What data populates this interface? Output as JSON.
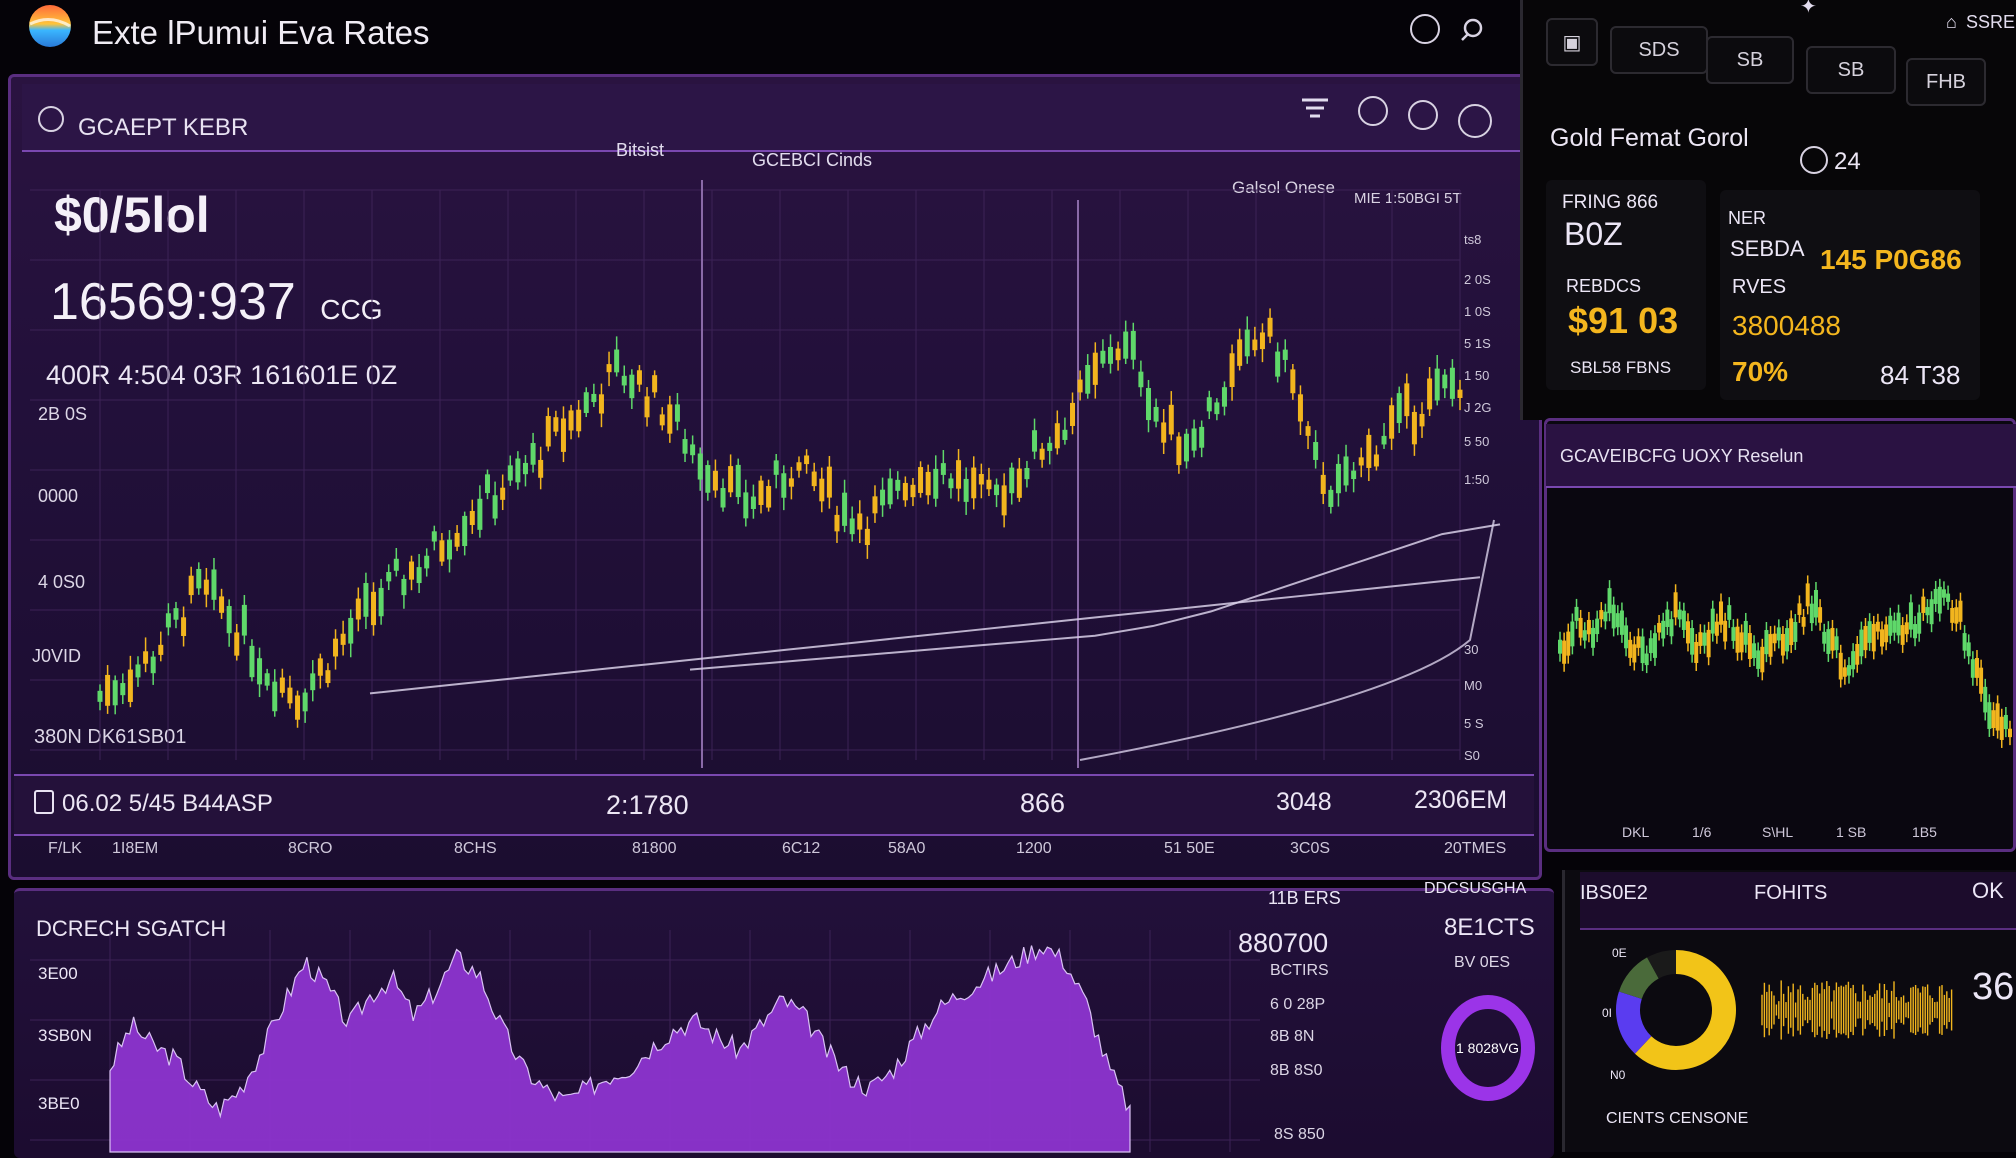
{
  "app": {
    "title": "Exte lPumui Eva Rates",
    "logo_icon": "globe-logo-icon"
  },
  "header": {
    "icons": [
      "refresh-icon",
      "settings-icon"
    ]
  },
  "main_panel": {
    "title": "GCAEPT KEBR",
    "subtabs": [
      "Bitsist",
      "GCEBCI Cinds"
    ],
    "toolbar_icons": [
      "menu-icon",
      "pause-icon",
      "clock-icon",
      "globe-icon"
    ],
    "price_small": "$0/5lol",
    "price_big": "16569:937",
    "price_big_suffix": "CCG",
    "price_sub": "400R 4:504 03R 161601E 0Z",
    "legend_left": "Galsol Onese",
    "legend_right": "MIE 1:50BGI 5T",
    "y_labels_left": [
      "2B 0S",
      "0000",
      "4 0S0",
      "J0VID",
      "380N DK61SB01"
    ],
    "y_labels_right": [
      "ts8",
      "2 0S",
      "1 0S",
      "5 1S",
      "1 50",
      "J 2G",
      "5 50",
      "1:50",
      "30",
      "M0",
      "5 S",
      "S0"
    ],
    "footer_stats": [
      "06.02 5/45 B44ASP",
      "2:1780",
      "866",
      "3048",
      "2306EM"
    ],
    "footer_icon": "document-icon",
    "x_labels": [
      "F/LK",
      "1I8EM",
      "8CRO",
      "8CHS",
      "81800",
      "6C12",
      "58A0",
      "1200",
      "51 50E",
      "3C0S",
      "20TMES"
    ]
  },
  "right_top": {
    "tabs": [
      "SDS",
      "SB",
      "SB",
      "FHB"
    ],
    "tab_icon": "chart-icon",
    "header_icons": [
      "star-icon",
      "tag-icon"
    ],
    "header_text": "SSRE",
    "title": "Gold Femat Gorol",
    "badge_icon": "clock-icon",
    "badge_value": "24",
    "card1": {
      "label": "FRING 866",
      "value": "B0Z",
      "sub_label": "REBDCS",
      "sub_value": "$91 03",
      "footer": "SBL58 FBNS"
    },
    "card2": {
      "label": "NER",
      "label2": "SEBDA",
      "value": "145 P0G86",
      "sub_label": "RVES",
      "sub_value": "3800488",
      "pct": "70%",
      "extra": "84 T38"
    }
  },
  "right_mid": {
    "title": "GCAVEIBCFG UOXY Reselun",
    "x_labels": [
      "DKL",
      "1/6",
      "S\\HL",
      "1 SB",
      "1B5"
    ]
  },
  "bottom_left": {
    "title": "DCRECH SGATCH",
    "y_labels": [
      "3E00",
      "3SB0N",
      "3BE0"
    ],
    "right_header": "11B ERS",
    "right_header2": "DDCSUSGHA",
    "value_main": "880700",
    "value_sub": "8E1CTS",
    "list": [
      "BCTIRS",
      "BV 0ES",
      "6 0 28P",
      "8B 8N",
      "8B 8S0",
      "8S 850"
    ],
    "donut_label": "1 8028VG"
  },
  "bottom_right": {
    "col1": "IBS0E2",
    "col2": "FOHITS",
    "col3": "OK",
    "value": "36",
    "footer": "CIENTS CENSONE",
    "donut_labels": [
      "0E",
      "0I",
      "N0"
    ]
  },
  "colors": {
    "background": "#050308",
    "panel_purple": "#2a1240",
    "accent_purple": "#9b4fe0",
    "candle_green": "#5fd86a",
    "candle_gold": "#f2b51e",
    "area_purple": "#8d34cf"
  },
  "chart_data": [
    {
      "type": "line",
      "title": "",
      "note": "main candlestick price chart (values in relative units 0-100)",
      "series": [
        {
          "values": [
            10,
            14,
            18,
            26,
            34,
            30,
            22,
            14,
            10,
            16,
            24,
            30,
            36,
            40,
            46,
            52,
            56,
            60,
            66,
            72,
            78,
            84,
            80,
            74,
            66,
            60,
            54,
            56,
            62,
            58,
            52,
            50,
            54,
            60,
            62,
            58,
            54,
            60,
            66,
            72,
            80,
            90,
            86,
            70,
            68,
            76,
            84,
            92,
            86,
            64,
            56,
            62,
            70,
            74,
            78,
            82
          ]
        },
        {
          "values": [
            12,
            14,
            16,
            18,
            20,
            22,
            24,
            26,
            28,
            30,
            32,
            34,
            36,
            38,
            40,
            42,
            44,
            46,
            48,
            50,
            52,
            54,
            56,
            58,
            60
          ]
        },
        {
          "values": [
            20,
            21,
            22,
            23,
            24,
            25,
            26,
            27,
            29,
            32,
            36,
            40,
            44,
            48,
            50
          ]
        }
      ]
    },
    {
      "type": "area",
      "title": "",
      "note": "bottom purple area chart (relative units 0-100)",
      "values": [
        40,
        60,
        50,
        44,
        30,
        20,
        30,
        48,
        70,
        90,
        78,
        60,
        74,
        82,
        64,
        76,
        92,
        84,
        60,
        40,
        30,
        24,
        30,
        36,
        40,
        50,
        58,
        62,
        54,
        48,
        60,
        72,
        64,
        48,
        36,
        30,
        38,
        52,
        66,
        74,
        80,
        86,
        92,
        98,
        90,
        70,
        40,
        20
      ]
    },
    {
      "type": "line",
      "title": "",
      "note": "right side candlestick mini chart (relative units 0-100)",
      "values": [
        50,
        62,
        56,
        70,
        54,
        48,
        60,
        66,
        52,
        58,
        64,
        56,
        48,
        54,
        60,
        72,
        58,
        42,
        50,
        62,
        56,
        60,
        70,
        78,
        64,
        40,
        20,
        12
      ]
    },
    {
      "type": "pie",
      "title": "",
      "categories": [
        "Gold",
        "Blue",
        "Green",
        "Dark"
      ],
      "values": [
        62,
        18,
        12,
        8
      ]
    }
  ]
}
